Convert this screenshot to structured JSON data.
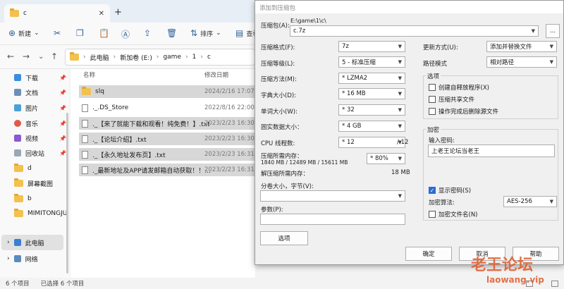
{
  "explorer": {
    "tab_title": "c",
    "toolbar": {
      "new": "新建",
      "sort": "排序",
      "view": "查看"
    },
    "address": {
      "segments": [
        "此电脑",
        "新加卷 (E:)",
        "game",
        "1",
        "c"
      ]
    },
    "columns": {
      "name": "名称",
      "date": "修改日期"
    },
    "sidebar": [
      {
        "label": "下载",
        "pinned": true
      },
      {
        "label": "文档",
        "pinned": true
      },
      {
        "label": "图片",
        "pinned": true
      },
      {
        "label": "音乐",
        "pinned": true
      },
      {
        "label": "视频",
        "pinned": true
      },
      {
        "label": "回收站",
        "pinned": true
      },
      {
        "label": "d"
      },
      {
        "label": "屏幕截图"
      },
      {
        "label": "b"
      },
      {
        "label": "MIMITONGJU"
      },
      {
        "label": "此电脑"
      },
      {
        "label": "网络"
      }
    ],
    "files": [
      {
        "name": "slq",
        "date": "2024/2/16 17:07",
        "type": "folder",
        "selected": true
      },
      {
        "name": "._.DS_Store",
        "date": "2022/8/16 22:00",
        "type": "file",
        "selected": false
      },
      {
        "name": "._【来了就能下载和观看！纯免费！】.txt",
        "date": "2023/2/23 16:30",
        "type": "file",
        "selected": true
      },
      {
        "name": "._【论坛介绍】.txt",
        "date": "2023/2/23 16:30",
        "type": "file",
        "selected": true
      },
      {
        "name": "._【永久地址发布页】.txt",
        "date": "2023/2/23 16:31",
        "type": "file",
        "selected": true
      },
      {
        "name": "._最新地址及APP请发邮箱自动获取！！...",
        "date": "2023/2/23 16:31",
        "type": "file",
        "selected": true
      }
    ],
    "status": {
      "count": "6 个项目",
      "selected": "已选择 6 个项目"
    }
  },
  "dialog": {
    "title": "添加到压缩包",
    "archive_label": "压缩包(A):",
    "archive_path": "E:\\game\\1\\c\\",
    "archive_name": "c.7z",
    "browse": "...",
    "format_label": "压缩格式(F):",
    "format": "7z",
    "level_label": "压缩等级(L):",
    "level": "5 - 标准压缩",
    "method_label": "压缩方法(M):",
    "method": "* LZMA2",
    "dict_label": "字典大小(D):",
    "dict": "* 16 MB",
    "word_label": "单词大小(W):",
    "word": "* 32",
    "solid_label": "固实数据大小：",
    "solid": "* 4 GB",
    "cpu_label": "CPU 线程数:",
    "cpu": "* 12",
    "cpu_max": "/ 12",
    "mem_comp_label": "压缩所需内存：",
    "mem_comp_detail": "1840 MB / 12489 MB / 15611 MB",
    "mem_pct": "* 80%",
    "mem_decomp_label": "解压缩所需内存：",
    "mem_decomp": "18 MB",
    "split_label": "分卷大小，字节(V):",
    "params_label": "参数(P):",
    "options_btn": "选项",
    "update_label": "更新方式(U):",
    "update": "添加并替换文件",
    "path_label": "路径模式",
    "path": "相对路径",
    "options_title": "选项",
    "opt_sfx": "创建自释放程序(X)",
    "opt_shared": "压缩共享文件",
    "opt_delete": "操作完成后删除源文件",
    "enc_title": "加密",
    "pwd_label": "输入密码:",
    "pwd_value": "上老王论坛当老王",
    "show_pwd": "显示密码(S)",
    "enc_method_label": "加密算法:",
    "enc_method": "AES-256",
    "enc_names": "加密文件名(N)",
    "ok": "确定",
    "cancel": "取消",
    "help": "帮助"
  },
  "watermark": {
    "line1": "老王论坛",
    "line2": "laowang.vip"
  }
}
